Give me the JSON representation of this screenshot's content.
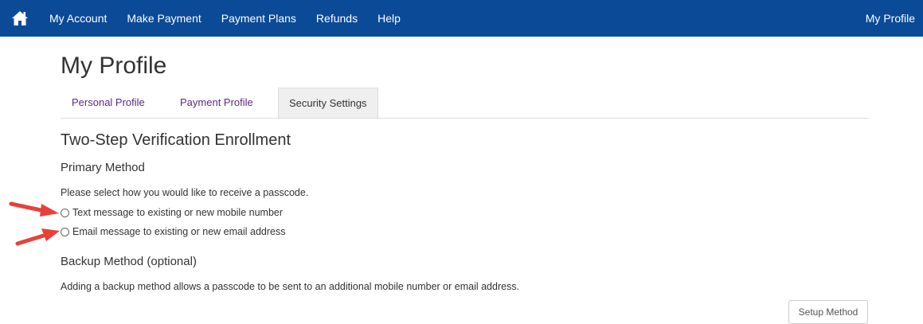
{
  "nav": {
    "items": [
      "My Account",
      "Make Payment",
      "Payment Plans",
      "Refunds",
      "Help"
    ],
    "right_label": "My Profile",
    "bg_color": "#0b4a96"
  },
  "page": {
    "title": "My Profile"
  },
  "tabs": [
    {
      "label": "Personal Profile",
      "active": false
    },
    {
      "label": "Payment Profile",
      "active": false
    },
    {
      "label": "Security Settings",
      "active": true
    }
  ],
  "section": {
    "title": "Two-Step Verification Enrollment",
    "primary": {
      "heading": "Primary Method",
      "instruction": "Please select how you would like to receive a passcode.",
      "options": [
        "Text message to existing or new mobile number",
        "Email message to existing or new email address"
      ]
    },
    "backup": {
      "heading": "Backup Method (optional)",
      "description": "Adding a backup method allows a passcode to be sent to an additional mobile number or email address.",
      "button_label": "Setup Method"
    }
  },
  "icons": {
    "home": "home-icon",
    "annotation": "red-arrow-icon"
  },
  "colors": {
    "tab_link": "#5a2a82",
    "arrow": "#e8413a"
  }
}
